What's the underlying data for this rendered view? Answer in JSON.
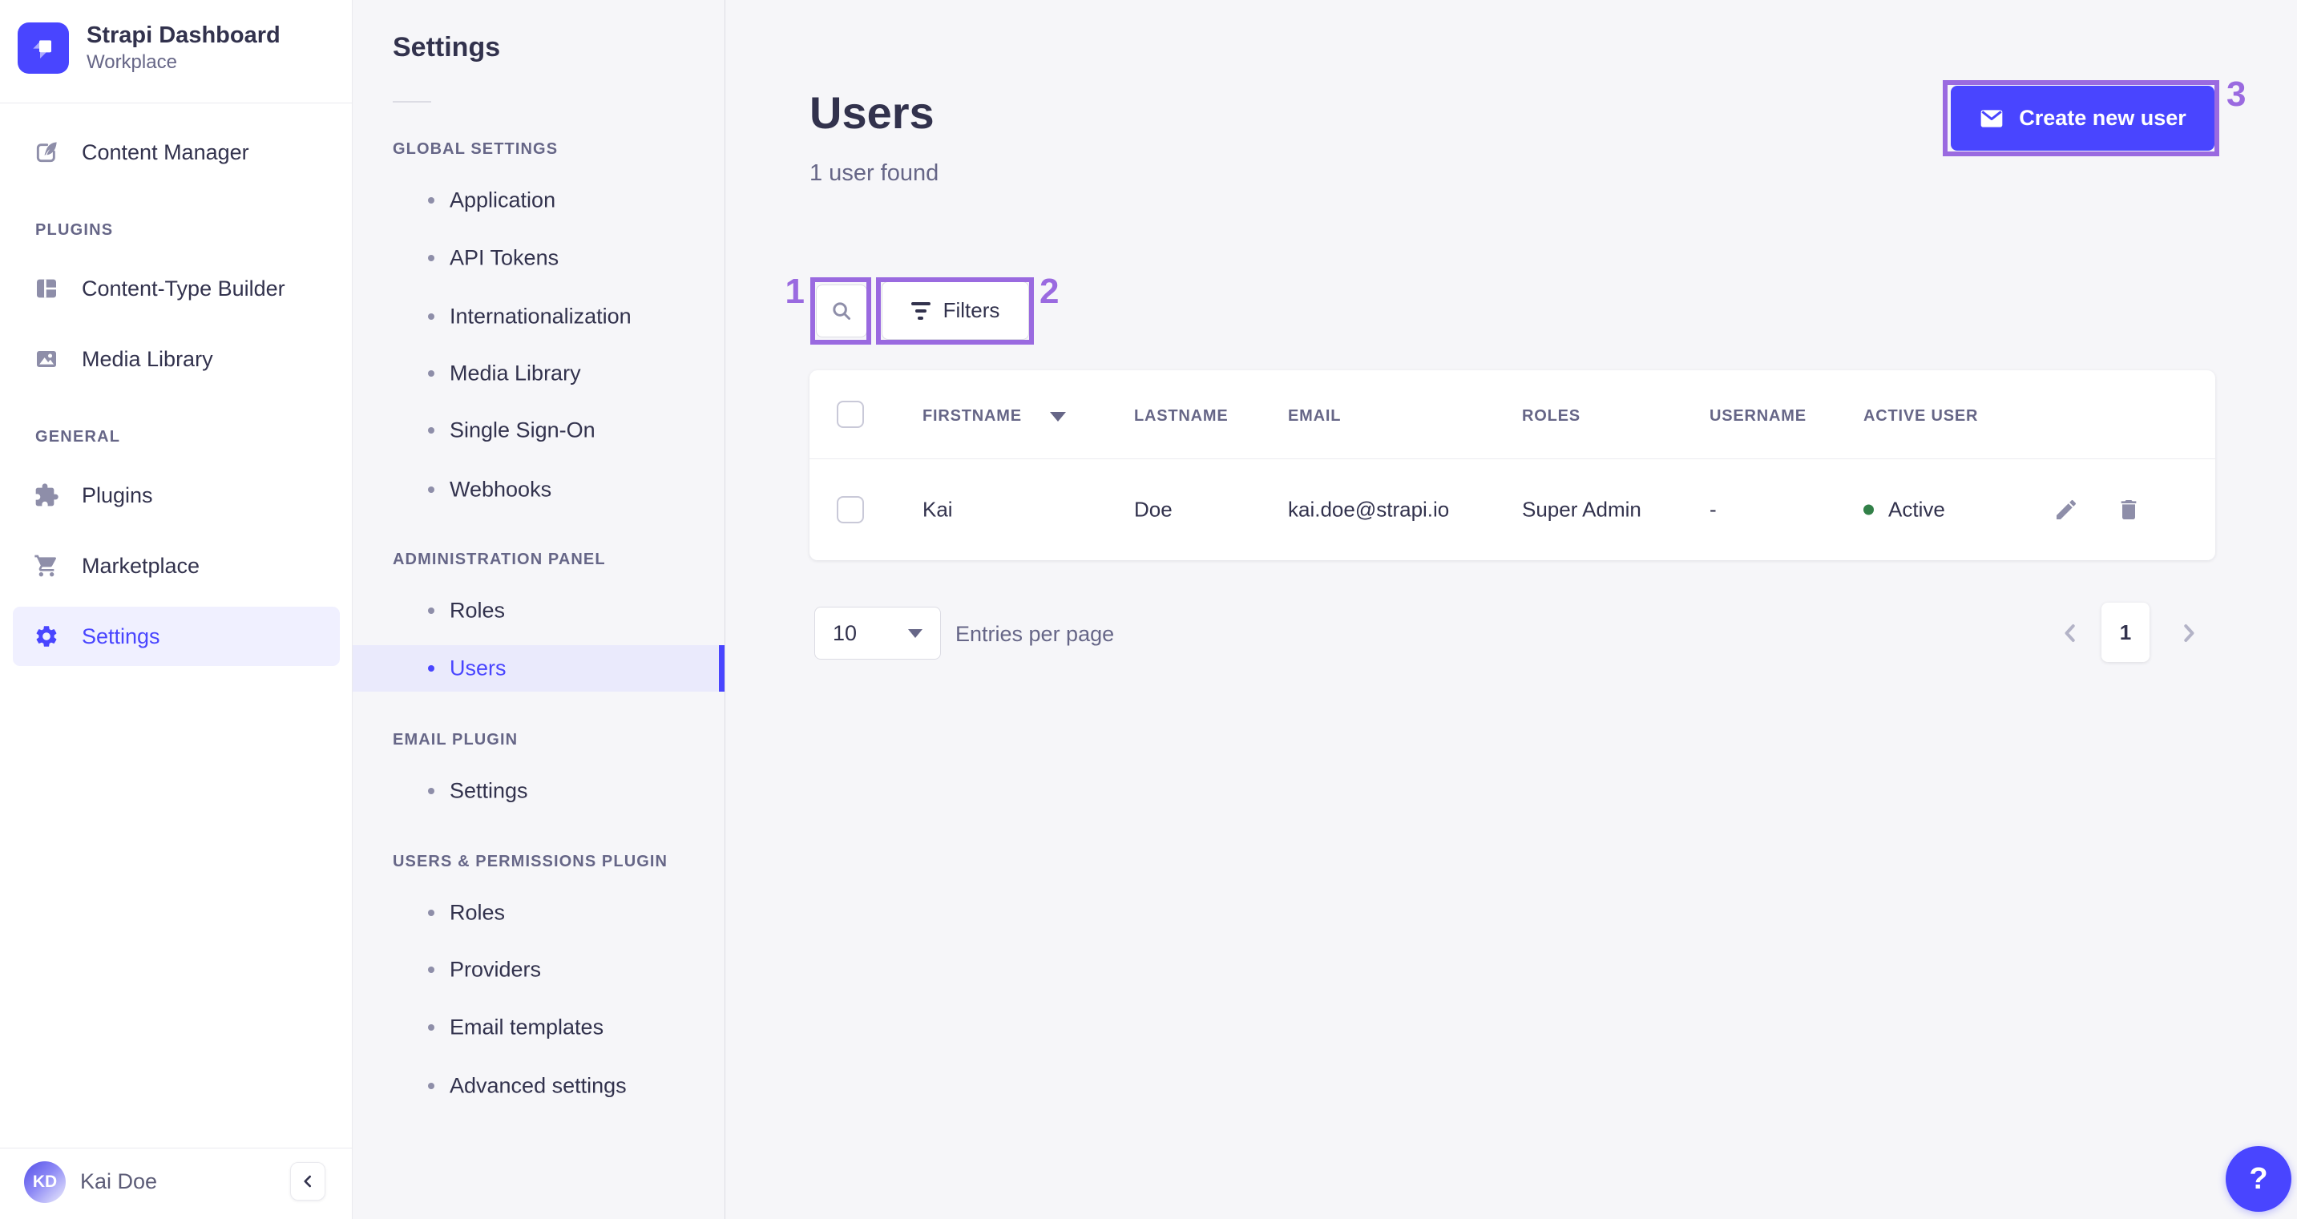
{
  "app": {
    "brand": "Strapi Dashboard",
    "workspace": "Workplace"
  },
  "sidebar": {
    "content_manager": "Content Manager",
    "sections": [
      {
        "label": "PLUGINS",
        "items": [
          {
            "label": "Content-Type Builder"
          },
          {
            "label": "Media Library"
          }
        ]
      },
      {
        "label": "GENERAL",
        "items": [
          {
            "label": "Plugins"
          },
          {
            "label": "Marketplace"
          },
          {
            "label": "Settings",
            "active": true
          }
        ]
      }
    ],
    "user": {
      "initials": "KD",
      "name": "Kai Doe"
    }
  },
  "subnav": {
    "title": "Settings",
    "sections": [
      {
        "label": "GLOBAL SETTINGS",
        "items": [
          {
            "label": "Application"
          },
          {
            "label": "API Tokens"
          },
          {
            "label": "Internationalization"
          },
          {
            "label": "Media Library"
          },
          {
            "label": "Single Sign-On"
          },
          {
            "label": "Webhooks"
          }
        ]
      },
      {
        "label": "ADMINISTRATION PANEL",
        "items": [
          {
            "label": "Roles"
          },
          {
            "label": "Users",
            "active": true
          }
        ]
      },
      {
        "label": "EMAIL PLUGIN",
        "items": [
          {
            "label": "Settings"
          }
        ]
      },
      {
        "label": "USERS & PERMISSIONS PLUGIN",
        "items": [
          {
            "label": "Roles"
          },
          {
            "label": "Providers"
          },
          {
            "label": "Email templates"
          },
          {
            "label": "Advanced settings"
          }
        ]
      }
    ]
  },
  "header": {
    "title": "Users",
    "subtitle": "1 user found",
    "create_button": "Create new user"
  },
  "toolbar": {
    "filters_button": "Filters"
  },
  "table": {
    "headers": {
      "firstname": "FIRSTNAME",
      "lastname": "LASTNAME",
      "email": "EMAIL",
      "roles": "ROLES",
      "username": "USERNAME",
      "active": "ACTIVE USER"
    },
    "rows": [
      {
        "firstname": "Kai",
        "lastname": "Doe",
        "email": "kai.doe@strapi.io",
        "roles": "Super Admin",
        "username": "-",
        "active_label": "Active"
      }
    ]
  },
  "pagination": {
    "page_size": "10",
    "entries_label": "Entries per page",
    "current_page": "1"
  },
  "help": {
    "label": "?"
  },
  "annotations": {
    "one": "1",
    "two": "2",
    "three": "3"
  },
  "colors": {
    "primary": "#4945ff",
    "primary_light": "#f0f0ff",
    "subnav_active_bg": "#eaeafc",
    "annotation": "#9a6ae0",
    "success": "#328048"
  }
}
